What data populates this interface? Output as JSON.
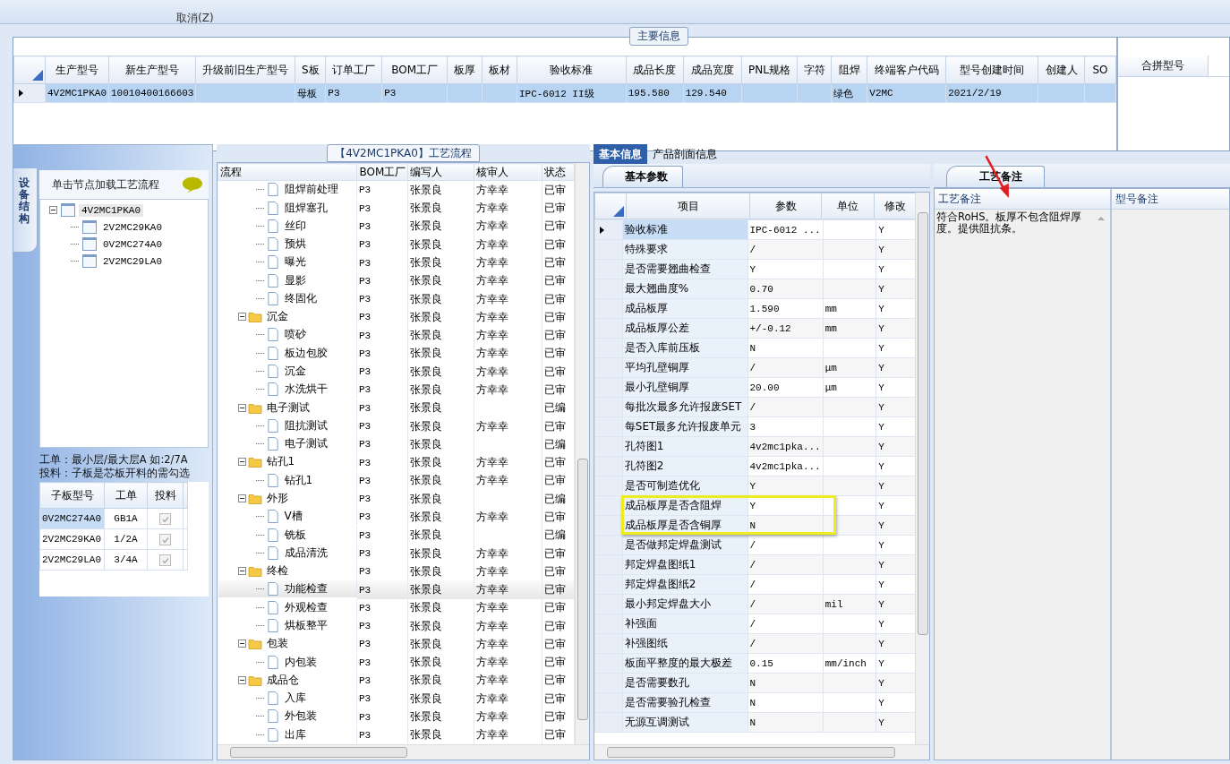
{
  "toolbar": {
    "buttons": [
      "取消(Z)"
    ]
  },
  "main_info": {
    "title": "主要信息",
    "columns": [
      "生产型号",
      "新生产型号",
      "升级前旧生产型号",
      "S板",
      "订单工厂",
      "BOM工厂",
      "板厚",
      "板材",
      "验收标准",
      "成品长度",
      "成品宽度",
      "PNL规格",
      "字符",
      "阻焊",
      "终端客户代码",
      "型号创建时间",
      "创建人",
      "SO"
    ],
    "rows": [
      {
        "selected": true,
        "cells": [
          "4V2MC1PKA0",
          "10010400166603",
          "",
          "母板",
          "P3",
          "P3",
          "",
          "",
          "IPC-6012 II级",
          "195.580",
          "129.540",
          "",
          "",
          "绿色",
          "V2MC",
          "2021/2/19",
          "",
          ""
        ]
      }
    ]
  },
  "merge_models": {
    "columns": [
      "合拼型号"
    ]
  },
  "structure_panel": {
    "tab": "设备结构",
    "header": "单击节点加载工艺流程",
    "tree": [
      {
        "label": "4V2MC1PKA0",
        "expanded": true,
        "selected": true,
        "children": [
          {
            "label": "2V2MC29KA0",
            "selected": false
          },
          {
            "label": "0V2MC274A0",
            "selected": false
          },
          {
            "label": "2V2MC29LA0",
            "selected": false
          }
        ]
      }
    ],
    "hint": [
      "工单：最小层/最大层A 如:2/7A",
      "投料：子板是芯板开料的需勾选"
    ],
    "sub_boards": {
      "columns": [
        "子板型号",
        "工单",
        "投料"
      ],
      "rows": [
        {
          "model": "0V2MC274A0",
          "order": "GB1A",
          "feed": true,
          "selected": true
        },
        {
          "model": "2V2MC29KA0",
          "order": "1/2A",
          "feed": true,
          "selected": false
        },
        {
          "model": "2V2MC29LA0",
          "order": "3/4A",
          "feed": true,
          "selected": false
        }
      ]
    }
  },
  "flow": {
    "title": "【4V2MC1PKA0】工艺流程",
    "columns": [
      "流程",
      "BOM工厂",
      "编写人",
      "核审人",
      "状态"
    ],
    "rows": [
      {
        "children": [
          {
            "label": "阻焊前处理",
            "bom": "P3",
            "author": "张景良",
            "reviewer": "方幸幸",
            "status": "已审",
            "selected": false
          },
          {
            "label": "阻焊塞孔",
            "bom": "P3",
            "author": "张景良",
            "reviewer": "方幸幸",
            "status": "已审",
            "selected": false
          },
          {
            "label": "丝印",
            "bom": "P3",
            "author": "张景良",
            "reviewer": "方幸幸",
            "status": "已审",
            "selected": false
          },
          {
            "label": "预烘",
            "bom": "P3",
            "author": "张景良",
            "reviewer": "方幸幸",
            "status": "已审",
            "selected": false
          },
          {
            "label": "曝光",
            "bom": "P3",
            "author": "张景良",
            "reviewer": "方幸幸",
            "status": "已审",
            "selected": false
          },
          {
            "label": "显影",
            "bom": "P3",
            "author": "张景良",
            "reviewer": "方幸幸",
            "status": "已审",
            "selected": false
          },
          {
            "label": "终固化",
            "bom": "P3",
            "author": "张景良",
            "reviewer": "方幸幸",
            "status": "已审",
            "selected": false
          }
        ]
      },
      {
        "label": "沉金",
        "bom": "P3",
        "author": "张景良",
        "reviewer": "方幸幸",
        "status": "已审",
        "selected": false,
        "expanded": true,
        "children": [
          {
            "label": "喷砂",
            "bom": "P3",
            "author": "张景良",
            "reviewer": "方幸幸",
            "status": "已审",
            "selected": false
          },
          {
            "label": "板边包胶",
            "bom": "P3",
            "author": "张景良",
            "reviewer": "方幸幸",
            "status": "已审",
            "selected": false
          },
          {
            "label": "沉金",
            "bom": "P3",
            "author": "张景良",
            "reviewer": "方幸幸",
            "status": "已审",
            "selected": false
          },
          {
            "label": "水洗烘干",
            "bom": "P3",
            "author": "张景良",
            "reviewer": "方幸幸",
            "status": "已审",
            "selected": false
          }
        ]
      },
      {
        "label": "电子测试",
        "bom": "P3",
        "author": "张景良",
        "status": "已编",
        "selected": false,
        "expanded": true,
        "children": [
          {
            "label": "阻抗测试",
            "bom": "P3",
            "author": "张景良",
            "reviewer": "方幸幸",
            "status": "已审",
            "selected": false
          },
          {
            "label": "电子测试",
            "bom": "P3",
            "author": "张景良",
            "status": "已编",
            "selected": false
          }
        ]
      },
      {
        "label": "钻孔1",
        "bom": "P3",
        "author": "张景良",
        "reviewer": "方幸幸",
        "status": "已审",
        "selected": false,
        "expanded": true,
        "children": [
          {
            "label": "钻孔1",
            "bom": "P3",
            "author": "张景良",
            "reviewer": "方幸幸",
            "status": "已审",
            "selected": false
          }
        ]
      },
      {
        "label": "外形",
        "bom": "P3",
        "author": "张景良",
        "status": "已编",
        "selected": false,
        "expanded": true,
        "children": [
          {
            "label": "V槽",
            "bom": "P3",
            "author": "张景良",
            "reviewer": "方幸幸",
            "status": "已审",
            "selected": false
          },
          {
            "label": "铣板",
            "bom": "P3",
            "author": "张景良",
            "status": "已编",
            "selected": false
          },
          {
            "label": "成品清洗",
            "bom": "P3",
            "author": "张景良",
            "reviewer": "方幸幸",
            "status": "已审",
            "selected": false
          }
        ]
      },
      {
        "label": "终检",
        "bom": "P3",
        "author": "张景良",
        "reviewer": "方幸幸",
        "status": "已审",
        "selected": false,
        "expanded": true,
        "children": [
          {
            "label": "功能检查",
            "bom": "P3",
            "author": "张景良",
            "reviewer": "方幸幸",
            "status": "已审",
            "selected": true
          },
          {
            "label": "外观检查",
            "bom": "P3",
            "author": "张景良",
            "reviewer": "方幸幸",
            "status": "已审",
            "selected": false
          },
          {
            "label": "烘板整平",
            "bom": "P3",
            "author": "张景良",
            "reviewer": "方幸幸",
            "status": "已审",
            "selected": false
          }
        ]
      },
      {
        "label": "包装",
        "bom": "P3",
        "author": "张景良",
        "reviewer": "方幸幸",
        "status": "已审",
        "selected": false,
        "expanded": true,
        "children": [
          {
            "label": "内包装",
            "bom": "P3",
            "author": "张景良",
            "reviewer": "方幸幸",
            "status": "已审",
            "selected": false
          }
        ]
      },
      {
        "label": "成品仓",
        "bom": "P3",
        "author": "张景良",
        "reviewer": "方幸幸",
        "status": "已审",
        "selected": false,
        "expanded": true,
        "children": [
          {
            "label": "入库",
            "bom": "P3",
            "author": "张景良",
            "reviewer": "方幸幸",
            "status": "已审",
            "selected": false
          },
          {
            "label": "外包装",
            "bom": "P3",
            "author": "张景良",
            "reviewer": "方幸幸",
            "status": "已审",
            "selected": false
          },
          {
            "label": "出库",
            "bom": "P3",
            "author": "张景良",
            "reviewer": "方幸幸",
            "status": "已审",
            "selected": false
          }
        ]
      }
    ]
  },
  "params": {
    "tabs": [
      {
        "label": "基本信息",
        "selected": true
      },
      {
        "label": "产品剖面信息",
        "selected": false
      }
    ],
    "subtab": "基本参数",
    "columns": [
      "项目",
      "参数",
      "单位",
      "修改"
    ],
    "rows": [
      {
        "item": "验收标准",
        "value": "IPC-6012 ...",
        "modify": "Y",
        "selected": true,
        "highlighted": false
      },
      {
        "item": "特殊要求",
        "value": "/",
        "modify": "Y",
        "selected": false,
        "highlighted": false
      },
      {
        "item": "是否需要翘曲检查",
        "value": "Y",
        "modify": "Y",
        "selected": false,
        "highlighted": false
      },
      {
        "item": "最大翘曲度%",
        "value": "0.70",
        "modify": "Y",
        "selected": false,
        "highlighted": false
      },
      {
        "item": "成品板厚",
        "value": "1.590",
        "unit": "mm",
        "modify": "Y",
        "selected": false,
        "highlighted": false
      },
      {
        "item": "成品板厚公差",
        "value": "+/-0.12",
        "unit": "mm",
        "modify": "Y",
        "selected": false,
        "highlighted": false
      },
      {
        "item": "是否入库前压板",
        "value": "N",
        "modify": "Y",
        "selected": false,
        "highlighted": false
      },
      {
        "item": "平均孔壁铜厚",
        "value": "/",
        "unit": "μm",
        "modify": "Y",
        "selected": false,
        "highlighted": false
      },
      {
        "item": "最小孔壁铜厚",
        "value": "20.00",
        "unit": "μm",
        "modify": "Y",
        "selected": false,
        "highlighted": false
      },
      {
        "item": "每批次最多允许报废SET",
        "value": "/",
        "modify": "Y",
        "selected": false,
        "highlighted": false
      },
      {
        "item": "每SET最多允许报废单元",
        "value": "3",
        "modify": "Y",
        "selected": false,
        "highlighted": false
      },
      {
        "item": "孔符图1",
        "value": "4v2mc1pka...",
        "modify": "Y",
        "selected": false,
        "highlighted": false
      },
      {
        "item": "孔符图2",
        "value": "4v2mc1pka...",
        "modify": "Y",
        "selected": false,
        "highlighted": false
      },
      {
        "item": "是否可制造优化",
        "value": "Y",
        "modify": "Y",
        "selected": false,
        "highlighted": false
      },
      {
        "item": "成品板厚是否含阻焊",
        "value": "Y",
        "modify": "Y",
        "selected": false,
        "highlighted": true
      },
      {
        "item": "成品板厚是否含铜厚",
        "value": "N",
        "modify": "Y",
        "selected": false,
        "highlighted": true
      },
      {
        "item": "是否做邦定焊盘测试",
        "value": "/",
        "modify": "Y",
        "selected": false,
        "highlighted": false
      },
      {
        "item": "邦定焊盘图纸1",
        "value": "/",
        "modify": "Y",
        "selected": false,
        "highlighted": false
      },
      {
        "item": "邦定焊盘图纸2",
        "value": "/",
        "modify": "Y",
        "selected": false,
        "highlighted": false
      },
      {
        "item": "最小邦定焊盘大小",
        "value": "/",
        "unit": "mil",
        "modify": "Y",
        "selected": false,
        "highlighted": false
      },
      {
        "item": "补强面",
        "value": "/",
        "modify": "Y",
        "selected": false,
        "highlighted": false
      },
      {
        "item": "补强图纸",
        "value": "/",
        "modify": "Y",
        "selected": false,
        "highlighted": false
      },
      {
        "item": "板面平整度的最大极差",
        "value": "0.15",
        "unit": "mm/inch",
        "modify": "Y",
        "selected": false,
        "highlighted": false
      },
      {
        "item": "是否需要数孔",
        "value": "N",
        "modify": "Y",
        "selected": false,
        "highlighted": false
      },
      {
        "item": "是否需要验孔检查",
        "value": "N",
        "modify": "Y",
        "selected": false,
        "highlighted": false
      },
      {
        "item": "无源互调测试",
        "value": "N",
        "modify": "Y",
        "selected": false,
        "highlighted": false
      }
    ]
  },
  "notes": {
    "tab": "工艺备注",
    "columns": [
      "工艺备注",
      "型号备注"
    ],
    "process_note": "符合RoHS。板厚不包含阻焊厚度。提供阻抗条。"
  }
}
